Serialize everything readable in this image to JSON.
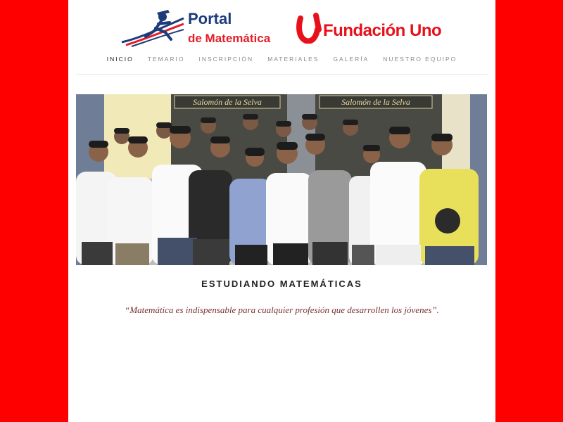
{
  "header": {
    "portal_line1": "Portal",
    "portal_line2": "de Matemática",
    "fundacion_name": "Fundación Uno"
  },
  "nav": {
    "items": [
      {
        "label": "INICIO",
        "active": true
      },
      {
        "label": "TEMARIO",
        "active": false
      },
      {
        "label": "INSCRIPCIÓN",
        "active": false
      },
      {
        "label": "MATERIALES",
        "active": false
      },
      {
        "label": "GALERÍA",
        "active": false
      },
      {
        "label": "NUESTRO EQUIPO",
        "active": false
      }
    ]
  },
  "hero": {
    "sign_left": "Salomón de la Selva",
    "sign_right": "Salomón de la Selva"
  },
  "main": {
    "title": "ESTUDIANDO MATEMÁTICAS",
    "quote": "“Matemática es indispensable para cualquier profesión que desarrollen los jóvenes”."
  },
  "colors": {
    "background": "#ff0000",
    "brand_red": "#e8101a",
    "brand_blue": "#1c3b7a",
    "nav_text": "#8a8a8a",
    "quote": "#7a2f2f"
  }
}
